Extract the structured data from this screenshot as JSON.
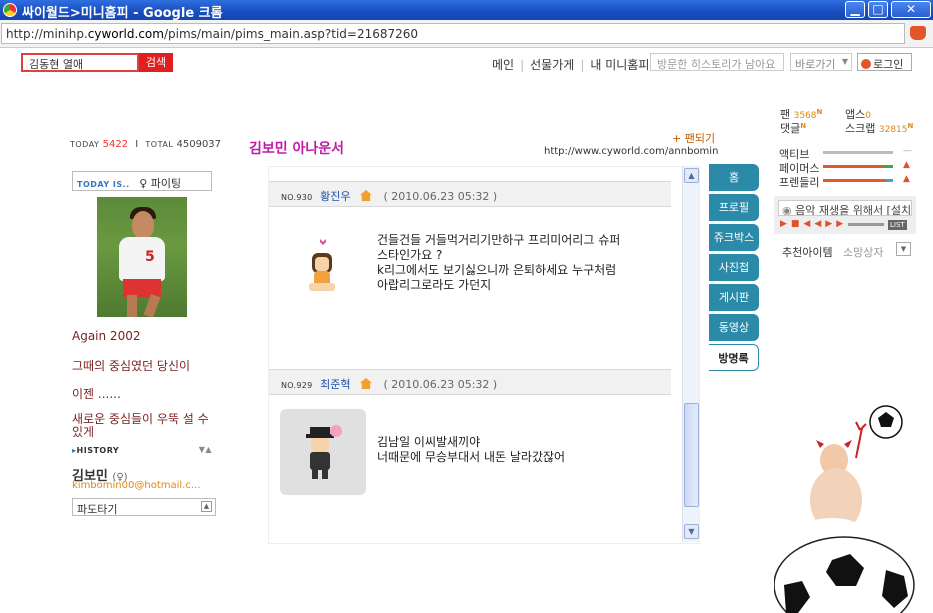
{
  "window": {
    "title": "싸이월드>미니홈피 - Google 크롬",
    "minimize": "▁",
    "maximize": "□",
    "close": "✕"
  },
  "address": {
    "prefix": "http://minihp.",
    "domain": "cyworld.com",
    "suffix": "/pims/main/pims_main.asp?tid=21687260"
  },
  "topnav": {
    "search_value": "김동현 열애",
    "search_button": "검색",
    "links": [
      "메인",
      "선물가게",
      "내 미니홈피"
    ],
    "history_placeholder": "방문한 히스토리가 남아요",
    "shortcut_label": "바로가기",
    "login_label": "로그인"
  },
  "profile": {
    "today_label": "TODAY",
    "today_count": "5422",
    "divider": "I",
    "total_label": "TOTAL",
    "total_count": "4509037",
    "today_is_label": "TODAY IS..",
    "mood_symbol": "♀",
    "mood": "파이팅",
    "intro_lines": [
      "Again 2002",
      "그때의 중심였던 당신이",
      "이젠 ......",
      "새로운 중심들이 우뚝 설 수 있게"
    ],
    "history_label": "HISTORY",
    "name": "김보민",
    "gender_symbol": "(♀)",
    "email": "kimbomin00@hotmail.c...",
    "wave_label": "파도타기"
  },
  "main": {
    "title": "김보민 아나운서",
    "fan_link": "+ 팬되기",
    "url": "http://www.cyworld.com/annbomin"
  },
  "guestbook": {
    "entries": [
      {
        "no_label": "NO.930",
        "name": "황진우",
        "date": "( 2010.06.23 05:32 )",
        "lines": [
          "건들건들 거들먹거리기만하구 프리미어리그 슈퍼",
          "스타인가요 ?",
          "k리그에서도 보기싫으니까 은퇴하세요 누구처럼",
          "아랍리그로라도 가던지"
        ]
      },
      {
        "no_label": "NO.929",
        "name": "최준혁",
        "date": "( 2010.06.23 05:32 )",
        "lines": [
          "김남일 이씨발새끼야",
          "너때문에 무승부대서 내돈 날라갔잖어"
        ]
      }
    ]
  },
  "menu_tabs": [
    "홈",
    "프로필",
    "쥬크박스",
    "사진첩",
    "게시판",
    "동영상",
    "방명록"
  ],
  "active_tab": "방명록",
  "stats": {
    "fan_label": "팬",
    "fan_value": "3568",
    "apps_label": "앱스",
    "apps_value": "0",
    "comment_label": "댓글",
    "scrap_label": "스크랩",
    "scrap_value": "32815",
    "new_mark": "N",
    "bars": [
      {
        "label": "액티브",
        "level": 0.0,
        "color": "#bbbbbb"
      },
      {
        "label": "페이머스",
        "level": 0.85,
        "color": "#3ca84a"
      },
      {
        "label": "프렌들리",
        "level": 0.9,
        "color": "#3aa6c8"
      }
    ],
    "activity_fill_color": "#e05a2a"
  },
  "music": {
    "text": "음악 재생을 위해서 [설치]",
    "list_label": "LIST"
  },
  "recommend": {
    "title": "추천아이템",
    "subtitle": "소망상자"
  },
  "colors": {
    "brand_orange": "#e08a10",
    "tab_teal": "#2a8aa8",
    "title_magenta": "#c21aa8"
  }
}
